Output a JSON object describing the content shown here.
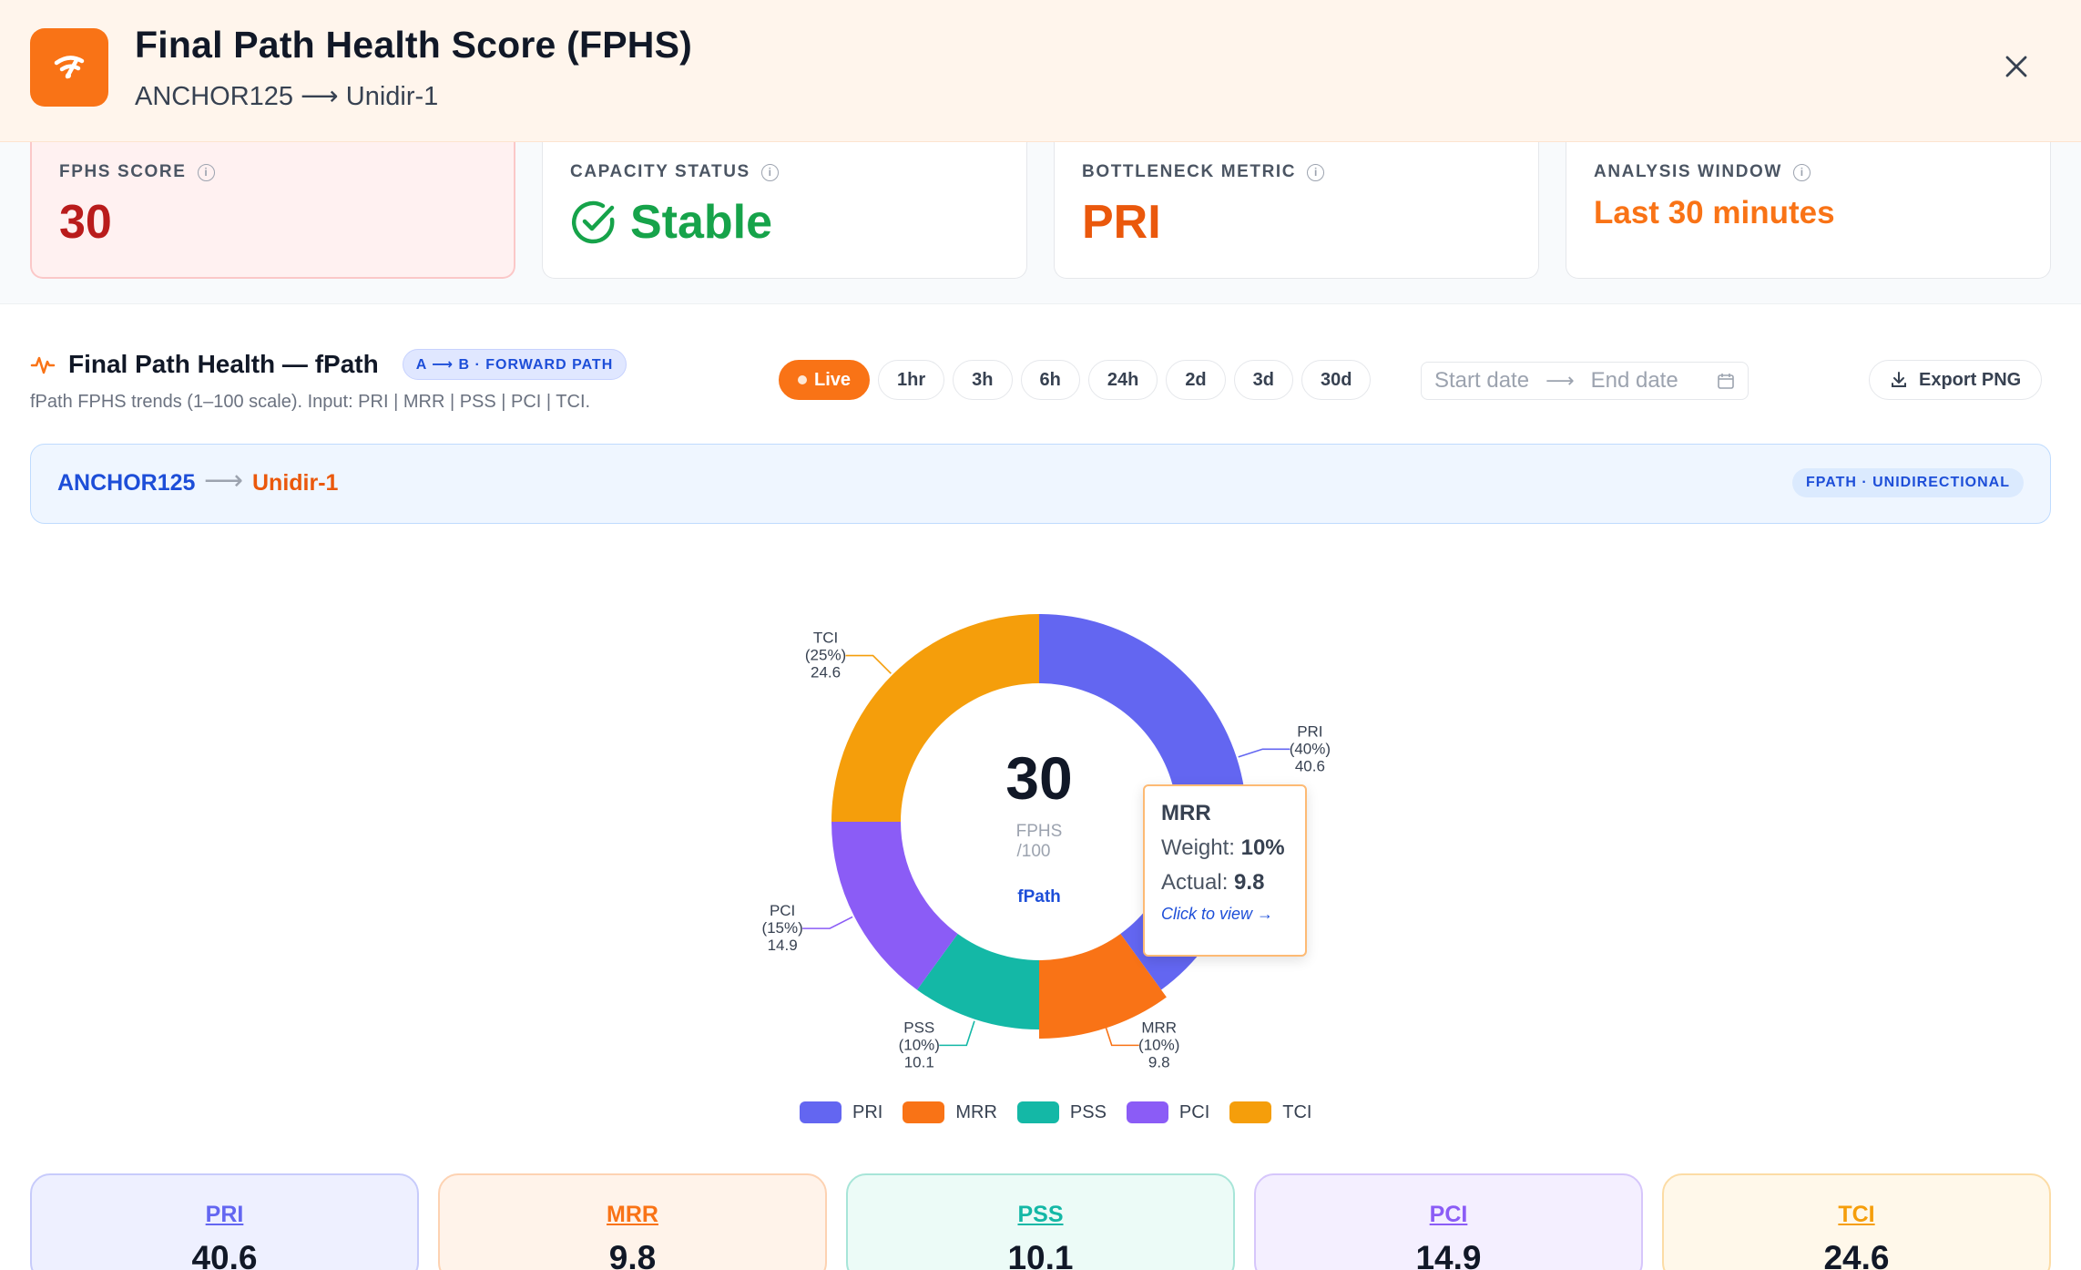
{
  "header": {
    "title": "Final Path Health Score (FPHS)",
    "subtitle": "ANCHOR125 ⟶ Unidir-1",
    "app_icon": "wifi-icon",
    "close_icon": "close-icon"
  },
  "kpis": {
    "score": {
      "label": "FPHS SCORE",
      "value": "30"
    },
    "capacity": {
      "label": "CAPACITY STATUS",
      "value": "Stable"
    },
    "bottleneck": {
      "label": "BOTTLENECK METRIC",
      "value": "PRI"
    },
    "window": {
      "label": "ANALYSIS WINDOW",
      "value": "Last 30 minutes"
    }
  },
  "section": {
    "title": "Final Path Health — fPath",
    "badge": "A ⟶ B · FORWARD PATH",
    "description": "fPath FPHS trends (1–100 scale). Input: PRI | MRR | PSS | PCI | TCI.",
    "ranges": [
      "Live",
      "1hr",
      "3h",
      "6h",
      "24h",
      "2d",
      "3d",
      "30d"
    ],
    "active_range": "Live",
    "start_placeholder": "Start date",
    "end_placeholder": "End date",
    "export_label": "Export PNG"
  },
  "route": {
    "source": "ANCHOR125",
    "destination": "Unidir-1",
    "arrow": "⟶",
    "badge": "FPATH · UNIDIRECTIONAL"
  },
  "center": {
    "value": "30",
    "unit_line1": "FPHS",
    "unit_line2": "/100",
    "path": "fPath"
  },
  "chart_data": {
    "type": "pie",
    "variant": "donut",
    "center_value": 30,
    "slices": [
      {
        "name": "PRI",
        "weight_pct": 40,
        "actual": 40.6,
        "color": "#6366f1",
        "label_pct": "(40%)",
        "label_val": "40.6"
      },
      {
        "name": "MRR",
        "weight_pct": 10,
        "actual": 9.8,
        "color": "#f97316",
        "label_pct": "(10%)",
        "label_val": "9.8"
      },
      {
        "name": "PSS",
        "weight_pct": 10,
        "actual": 10.1,
        "color": "#14b8a6",
        "label_pct": "(10%)",
        "label_val": "10.1"
      },
      {
        "name": "PCI",
        "weight_pct": 15,
        "actual": 14.9,
        "color": "#8b5cf6",
        "label_pct": "(15%)",
        "label_val": "14.9"
      },
      {
        "name": "TCI",
        "weight_pct": 25,
        "actual": 24.6,
        "color": "#f59e0b",
        "label_pct": "(25%)",
        "label_val": "24.6"
      }
    ],
    "highlighted": "MRR",
    "legend": [
      "PRI",
      "MRR",
      "PSS",
      "PCI",
      "TCI"
    ]
  },
  "tooltip": {
    "name": "MRR",
    "weight_label": "Weight:",
    "weight_value": "10%",
    "actual_label": "Actual:",
    "actual_value": "9.8",
    "link": "Click to view →"
  },
  "metrics": [
    {
      "name": "PRI",
      "value": "40.6"
    },
    {
      "name": "MRR",
      "value": "9.8"
    },
    {
      "name": "PSS",
      "value": "10.1"
    },
    {
      "name": "PCI",
      "value": "14.9"
    },
    {
      "name": "TCI",
      "value": "24.6"
    }
  ],
  "colors": {
    "accent": "#f97316",
    "pri": "#6366f1",
    "mrr": "#f97316",
    "pss": "#14b8a6",
    "pci": "#8b5cf6",
    "tci": "#f59e0b",
    "stable": "#16a34a",
    "danger": "#b91c1c"
  }
}
